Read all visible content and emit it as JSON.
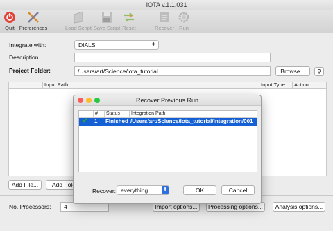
{
  "window": {
    "title": "IOTA v.1.1.031"
  },
  "toolbar": {
    "quit": "Quit",
    "preferences": "Preferences",
    "load_script": "Load Script",
    "save_script": "Save Script",
    "reset": "Reset",
    "recover": "Recover",
    "run": "Run"
  },
  "form": {
    "integrate_label": "Integrate with:",
    "integrate_value": "DIALS",
    "description_label": "Description",
    "description_value": "",
    "project_label": "Project Folder:",
    "project_value": "/Users/art/Science/iota_tutorial",
    "browse_button": "Browse..."
  },
  "table": {
    "columns": [
      "Input Path",
      "Input Type",
      "Action"
    ]
  },
  "bottom": {
    "add_file_button": "Add File...",
    "add_folder_button": "Add Folc",
    "processors_label": "No. Processors:",
    "processors_value": "4",
    "import_options_button": "Import options...",
    "processing_options_button": "Processing options...",
    "analysis_options_button": "Analysis options..."
  },
  "dialog": {
    "title": "Recover Previous Run",
    "columns": [
      "#",
      "Status",
      "Integration Path"
    ],
    "rows": [
      {
        "check": "✔",
        "num": "1",
        "status": "Finished",
        "path": "/Users/art/Science/iota_tutorial/integration/001"
      }
    ],
    "recover_label": "Recover:",
    "recover_value": "everything",
    "ok_button": "OK",
    "cancel_button": "Cancel"
  },
  "colors": {
    "selection": "#1560d4",
    "check": "#2fa82f",
    "close_traffic": "#fc5f57",
    "min_traffic": "#fdbc2e",
    "max_traffic": "#29c841"
  }
}
